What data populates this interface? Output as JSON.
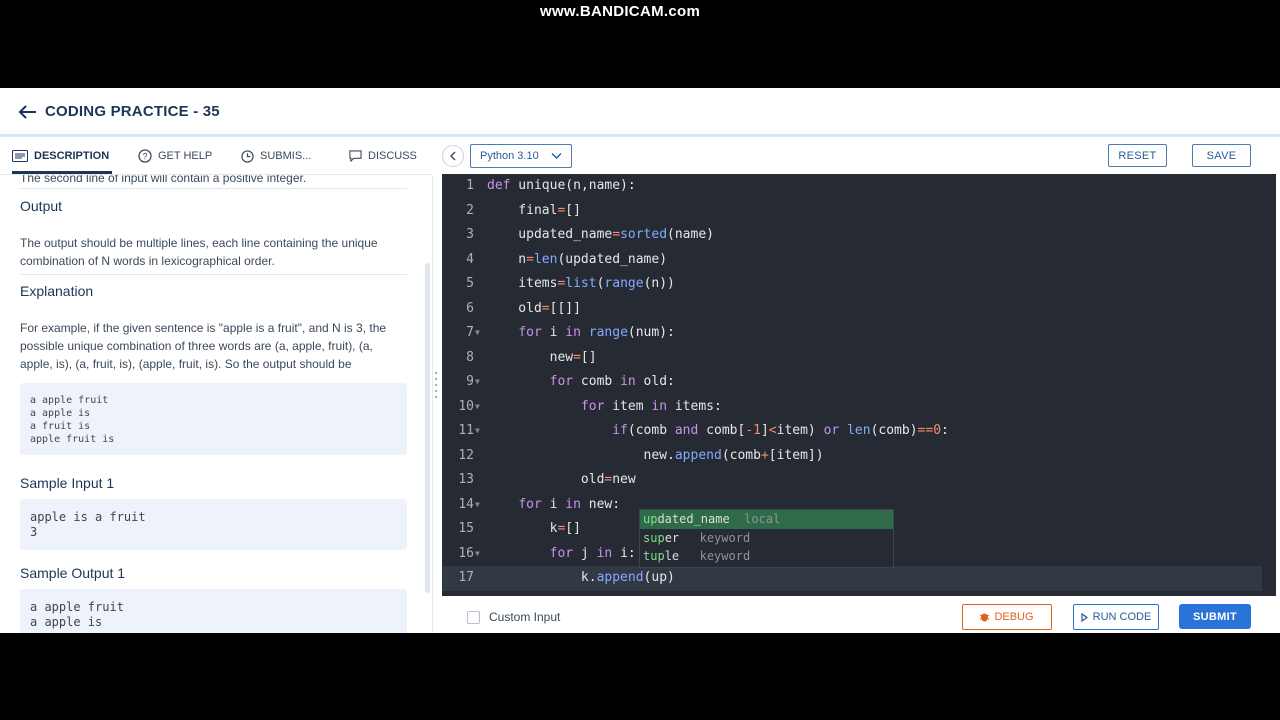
{
  "watermark": "www.BANDICAM.com",
  "header": {
    "title": "CODING PRACTICE - 35"
  },
  "tabs": [
    {
      "label": "DESCRIPTION"
    },
    {
      "label": "GET HELP"
    },
    {
      "label": "SUBMIS..."
    },
    {
      "label": "DISCUSS"
    }
  ],
  "description": {
    "partial_line": "The second line of input will contain a positive integer.",
    "output_heading": "Output",
    "output_text_1": "The output should be multiple lines, each line containing the unique",
    "output_text_2": "combination of N words in lexicographical order.",
    "explanation_heading": "Explanation",
    "explanation_1": "For example, if the given sentence is \"apple is a fruit\", and N is 3, the",
    "explanation_2": "possible unique combination of three words are (a, apple, fruit), (a,",
    "explanation_3": "apple, is), (a, fruit, is), (apple, fruit, is). So the output should be",
    "example_lines": [
      "a apple fruit",
      "a apple is",
      "a fruit is",
      "apple fruit is"
    ],
    "sample_input_heading": "Sample Input 1",
    "sample_input_lines": [
      "apple is a fruit",
      "3"
    ],
    "sample_output_heading": "Sample Output 1",
    "sample_output_lines": [
      "a apple fruit",
      "a apple is"
    ]
  },
  "toolbar": {
    "language": "Python 3.10",
    "reset_label": "RESET",
    "save_label": "SAVE"
  },
  "code_lines": [
    "def unique(n,name):",
    "    final=[]",
    "    updated_name=sorted(name)",
    "    n=len(updated_name)",
    "    items=list(range(n))",
    "    old=[[]]",
    "    for i in range(num):",
    "        new=[]",
    "        for comb in old:",
    "            for item in items:",
    "                if(comb and comb[-1]<item) or len(comb)==0:",
    "                    new.append(comb+[item])",
    "            old=new",
    "    for i in new:",
    "        k=[]",
    "        for j in i:",
    "            k.append(up)"
  ],
  "autocomplete": [
    {
      "match": "up",
      "rest": "dated_name",
      "kind": "local"
    },
    {
      "match": "sup",
      "rest": "er",
      "kind": "keyword"
    },
    {
      "match": "tup",
      "rest": "le",
      "kind": "keyword"
    }
  ],
  "bottom": {
    "custom_input_label": "Custom Input",
    "debug_label": "DEBUG",
    "run_label": "RUN CODE",
    "submit_label": "SUBMIT"
  },
  "colors": {
    "accent": "#2a73d9",
    "debug": "#e0611f",
    "editor_bg": "#262b33"
  }
}
